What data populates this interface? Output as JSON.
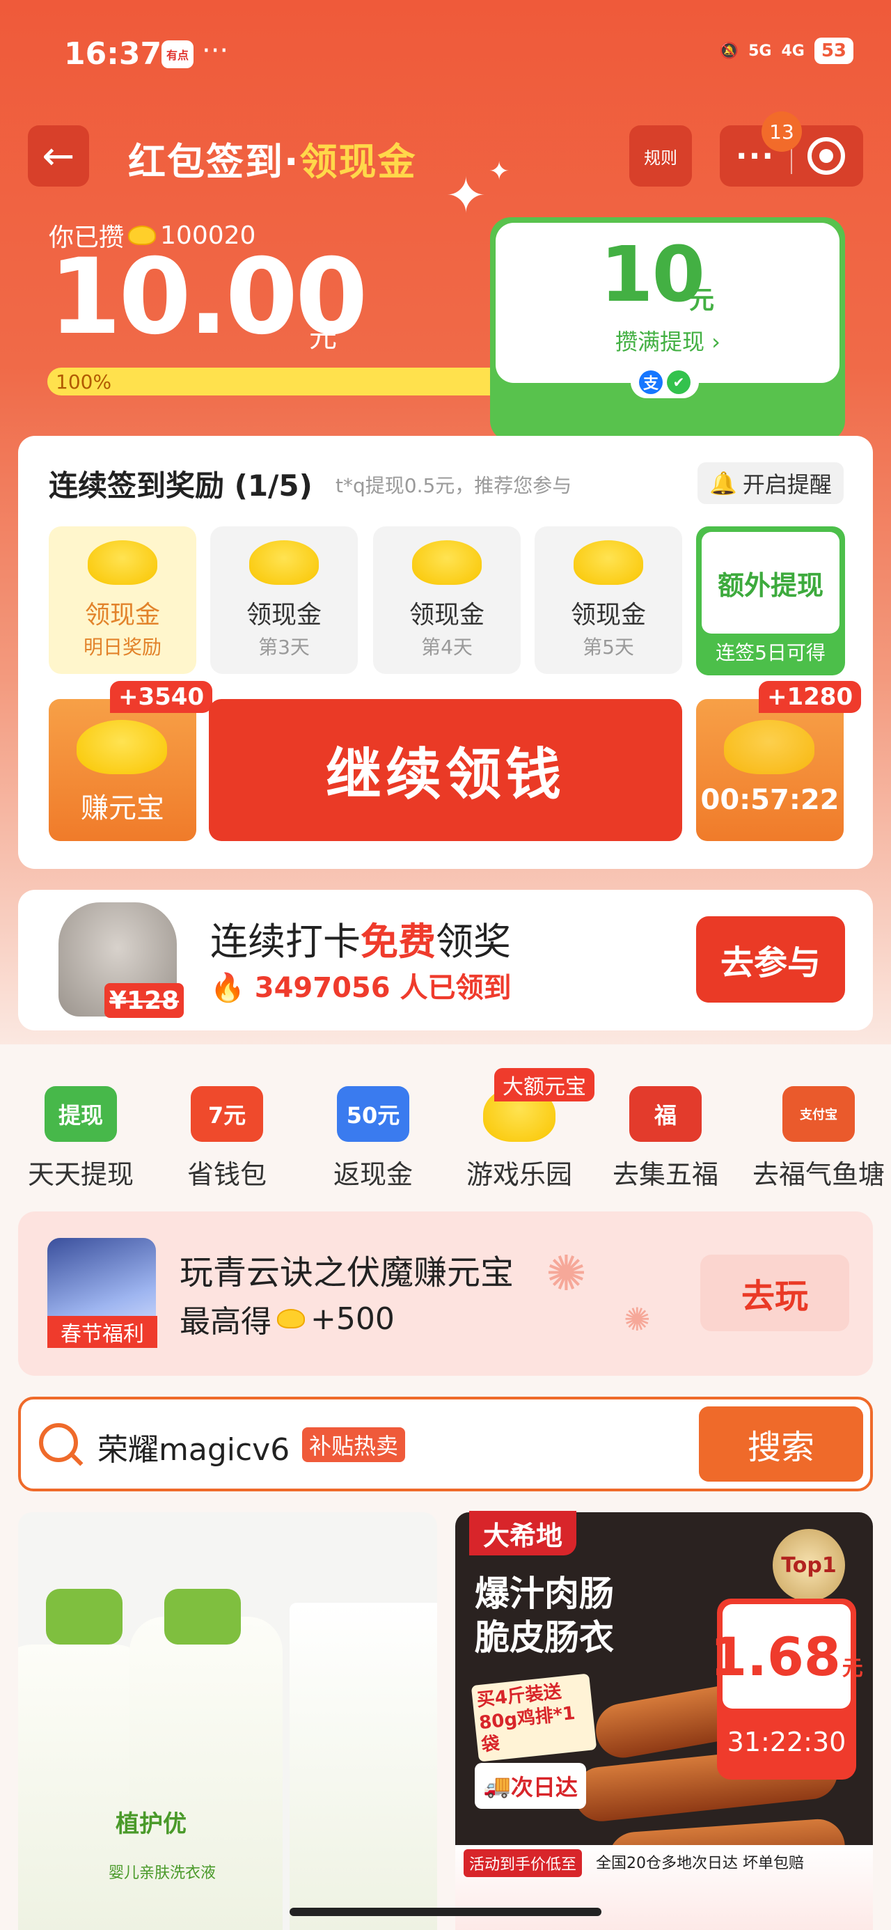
{
  "status_bar": {
    "time": "16:37",
    "app_badge": "有点",
    "dots": "···",
    "net_5g": "5G",
    "net_4g": "4G",
    "battery": "53"
  },
  "header": {
    "title_main": "红包签到·",
    "title_accent": "领现金",
    "rule": "规则",
    "more": "···",
    "badge": "13"
  },
  "balance": {
    "saved_prefix": "你已攒",
    "coins": "100020",
    "amount": "10.00",
    "unit": "元",
    "progress_label": "100%",
    "progress": 1.0
  },
  "withdraw": {
    "amount": "10",
    "unit": "元",
    "link": "攒满提现 ›",
    "alipay": "支",
    "wechat": "✔"
  },
  "sign": {
    "title": "连续签到奖励 (1/5)",
    "subtitle": "t*q提现0.5元，推荐您参与",
    "remind": "开启提醒",
    "days": [
      {
        "label": "领现金",
        "sub": "明日奖励"
      },
      {
        "label": "领现金",
        "sub": "第3天"
      },
      {
        "label": "领现金",
        "sub": "第4天"
      },
      {
        "label": "领现金",
        "sub": "第5天"
      }
    ],
    "extra": {
      "label": "额外提现",
      "sub": "连签5日可得"
    },
    "earn": {
      "label": "赚元宝",
      "badge": "+3540"
    },
    "continue": "继续领钱",
    "timer": {
      "label": "00:57:22",
      "badge": "+1280"
    }
  },
  "promo": {
    "title_pre": "连续打卡",
    "title_red": "免费",
    "title_post": "领奖",
    "count": "3497056 人已领到",
    "price": "¥128",
    "join": "去参与"
  },
  "grid": {
    "tag": "大额元宝",
    "items": [
      {
        "icon": "提现",
        "label": "天天提现",
        "color": "#47b84a"
      },
      {
        "icon": "7元",
        "label": "省钱包",
        "color": "#ef4a2c"
      },
      {
        "icon": "50元",
        "label": "返现金",
        "color": "#3a7bef"
      },
      {
        "icon": "",
        "label": "游戏乐园",
        "color": "#ffd23a"
      },
      {
        "icon": "福",
        "label": "去集五福",
        "color": "#e33b2c"
      },
      {
        "icon": "支付宝",
        "label": "去福气鱼塘",
        "color": "#ea5a2c"
      }
    ]
  },
  "game": {
    "tag": "春节福利",
    "title": "玩青云诀之伏魔赚元宝",
    "reward_prefix": "最高得",
    "reward": "+500",
    "play": "去玩"
  },
  "search": {
    "query": "荣耀magicv6",
    "badge": "补贴热卖",
    "button": "搜索"
  },
  "products": {
    "left": {
      "label1": "植护优",
      "label2": "婴儿亲肤洗衣液"
    },
    "right": {
      "brand": "大希地",
      "headline1": "爆汁肉肠",
      "headline2": "脆皮肠衣",
      "top": "Top1",
      "price": "1.68",
      "price_unit": "元",
      "timer": "31:22:30",
      "promo1": "买4斤装送",
      "promo2": "80g鸡排*1袋",
      "delivery": "次日达",
      "strip_left": "活动到手价低至",
      "strip_right": "全国20仓多地次日达 坏单包赔"
    }
  }
}
